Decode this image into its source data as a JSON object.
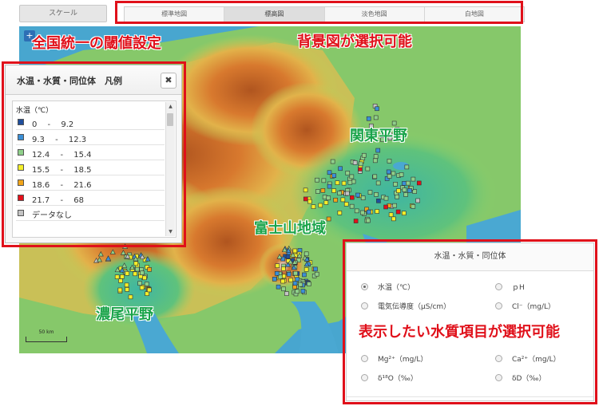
{
  "toolbar": {
    "scale_button": "スケール",
    "layer_tabs": [
      {
        "label": "標準地図",
        "active": false
      },
      {
        "label": "標高図",
        "active": true
      },
      {
        "label": "淡色地図",
        "active": false
      },
      {
        "label": "白地図",
        "active": false
      }
    ]
  },
  "map": {
    "zoom_icon": "+",
    "scale_label": "50 km"
  },
  "annotations": {
    "threshold": "全国統一の閾値設定",
    "background": "背景図が選択可能",
    "kanto": "関東平野",
    "fuji": "富士山地域",
    "nobi": "濃尾平野",
    "item_select": "表示したい水質項目が選択可能"
  },
  "legend": {
    "title": "水温・水質・同位体　凡例",
    "close_icon": "✖",
    "section_header": "水温（℃）",
    "items": [
      {
        "label": "0　 -　 9.2",
        "color": "#1f4e9c"
      },
      {
        "label": "9.3　 -　 12.3",
        "color": "#3b8fd6"
      },
      {
        "label": "12.4　 -　 15.4",
        "color": "#8fd08a"
      },
      {
        "label": "15.5　 -　 18.5",
        "color": "#f4ef2a"
      },
      {
        "label": "18.6　 -　 21.6",
        "color": "#f2a51a"
      },
      {
        "label": "21.7　 -　 68",
        "color": "#e4101a"
      },
      {
        "label": "データなし",
        "color": "#c4c4c4"
      }
    ],
    "scroll_up": "▲",
    "scroll_down": "▼"
  },
  "params": {
    "title": "水温・水質・同位体",
    "options": [
      {
        "label": "水温（℃）",
        "selected": true
      },
      {
        "label": "ｐH",
        "selected": false
      },
      {
        "label": "電気伝導度（μS/cm）",
        "selected": false
      },
      {
        "label": "Cl⁻（mg/L）",
        "selected": false
      },
      {
        "label": "Mg²⁺（mg/L）",
        "selected": false
      },
      {
        "label": "Ca²⁺（mg/L）",
        "selected": false
      },
      {
        "label": "δ¹⁸O（‰）",
        "selected": false
      },
      {
        "label": "δD（‰）",
        "selected": false
      }
    ]
  },
  "colors": {
    "accent_red": "#e0101a",
    "accent_green": "#1aa44a"
  }
}
